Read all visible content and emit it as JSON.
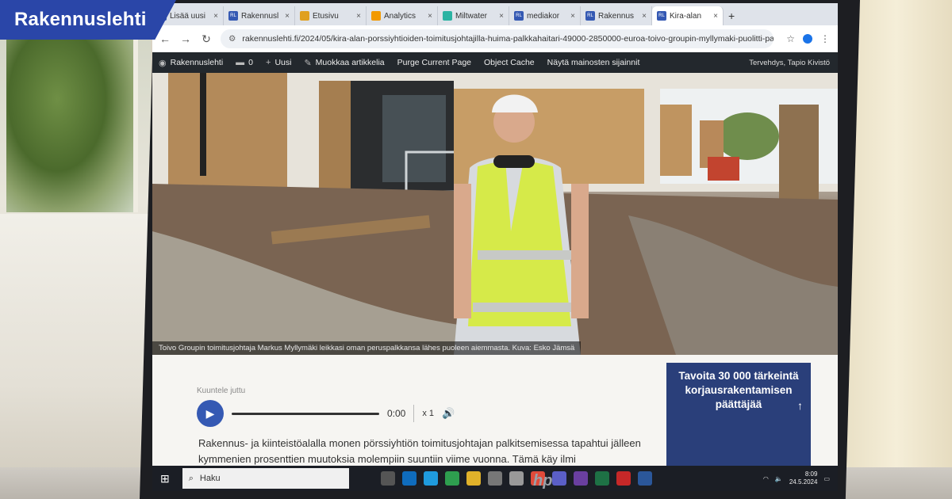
{
  "brand_badge": "Rakennuslehti",
  "browser": {
    "tabs": [
      {
        "favicon": "RL",
        "label": "Lisää uusi"
      },
      {
        "favicon": "RL",
        "label": "Rakennusl"
      },
      {
        "favicon": "folder",
        "label": "Etusivu"
      },
      {
        "favicon": "chart",
        "label": "Analytics"
      },
      {
        "favicon": "wave",
        "label": "Miltwater"
      },
      {
        "favicon": "RL",
        "label": "mediakor"
      },
      {
        "favicon": "RL",
        "label": "Rakennus"
      },
      {
        "favicon": "RL",
        "label": "Kira-alan"
      }
    ],
    "url": "rakennuslehti.fi/2024/05/kira-alan-porssiyhtioiden-toimitusjohtajilla-huima-palkkahaitari-49000-2850000-euroa-toivo-groupin-myllymaki-puolitti-palkkansa/"
  },
  "wp_admin_bar": {
    "site_name": "Rakennuslehti",
    "comments_count": "0",
    "new_label": "Uusi",
    "edit_label": "Muokkaa artikkelia",
    "purge_label": "Purge Current Page",
    "object_cache_label": "Object Cache",
    "show_ads_label": "Näytä mainosten sijainnit",
    "greeting": "Tervehdys, Tapio Kivistö"
  },
  "hero": {
    "caption": "Toivo Groupin toimitusjohtaja Markus Myllymäki leikkasi oman peruspalkkansa lähes puoleen aiemmasta. Kuva: Esko Jämsä"
  },
  "player": {
    "label": "Kuuntele juttu",
    "time": "0:00",
    "speed": "x 1"
  },
  "article": {
    "lead_line1": "Rakennus- ja kiinteistöalalla monen pörssiyhtiön toimitusjohtajan palkitsemisessa tapahtui jälleen",
    "lead_line2": "kymmenien prosenttien muutoksia molempiin suuntiin viime vuonna. Tämä käy ilmi Rakennuslehden"
  },
  "ad": {
    "line1": "Tavoita 30 000 tärkeintä",
    "line2": "korjausrakentamisen",
    "line3": "päättäjää"
  },
  "taskbar": {
    "search_placeholder": "Haku",
    "clock_time": "8:09",
    "clock_date": "24.5.2024"
  }
}
